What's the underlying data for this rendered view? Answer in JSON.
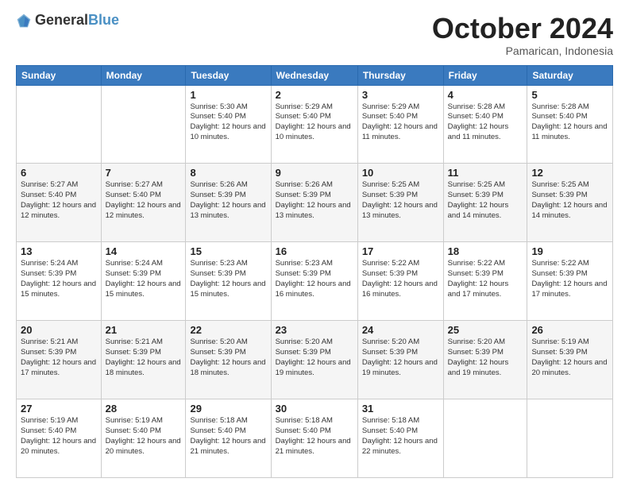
{
  "logo": {
    "text_general": "General",
    "text_blue": "Blue"
  },
  "header": {
    "month": "October 2024",
    "location": "Pamarican, Indonesia"
  },
  "days_of_week": [
    "Sunday",
    "Monday",
    "Tuesday",
    "Wednesday",
    "Thursday",
    "Friday",
    "Saturday"
  ],
  "weeks": [
    [
      null,
      null,
      {
        "day": 1,
        "sunrise": "5:30 AM",
        "sunset": "5:40 PM",
        "daylight": "12 hours and 10 minutes."
      },
      {
        "day": 2,
        "sunrise": "5:29 AM",
        "sunset": "5:40 PM",
        "daylight": "12 hours and 10 minutes."
      },
      {
        "day": 3,
        "sunrise": "5:29 AM",
        "sunset": "5:40 PM",
        "daylight": "12 hours and 11 minutes."
      },
      {
        "day": 4,
        "sunrise": "5:28 AM",
        "sunset": "5:40 PM",
        "daylight": "12 hours and 11 minutes."
      },
      {
        "day": 5,
        "sunrise": "5:28 AM",
        "sunset": "5:40 PM",
        "daylight": "12 hours and 11 minutes."
      }
    ],
    [
      {
        "day": 6,
        "sunrise": "5:27 AM",
        "sunset": "5:40 PM",
        "daylight": "12 hours and 12 minutes."
      },
      {
        "day": 7,
        "sunrise": "5:27 AM",
        "sunset": "5:40 PM",
        "daylight": "12 hours and 12 minutes."
      },
      {
        "day": 8,
        "sunrise": "5:26 AM",
        "sunset": "5:39 PM",
        "daylight": "12 hours and 13 minutes."
      },
      {
        "day": 9,
        "sunrise": "5:26 AM",
        "sunset": "5:39 PM",
        "daylight": "12 hours and 13 minutes."
      },
      {
        "day": 10,
        "sunrise": "5:25 AM",
        "sunset": "5:39 PM",
        "daylight": "12 hours and 13 minutes."
      },
      {
        "day": 11,
        "sunrise": "5:25 AM",
        "sunset": "5:39 PM",
        "daylight": "12 hours and 14 minutes."
      },
      {
        "day": 12,
        "sunrise": "5:25 AM",
        "sunset": "5:39 PM",
        "daylight": "12 hours and 14 minutes."
      }
    ],
    [
      {
        "day": 13,
        "sunrise": "5:24 AM",
        "sunset": "5:39 PM",
        "daylight": "12 hours and 15 minutes."
      },
      {
        "day": 14,
        "sunrise": "5:24 AM",
        "sunset": "5:39 PM",
        "daylight": "12 hours and 15 minutes."
      },
      {
        "day": 15,
        "sunrise": "5:23 AM",
        "sunset": "5:39 PM",
        "daylight": "12 hours and 15 minutes."
      },
      {
        "day": 16,
        "sunrise": "5:23 AM",
        "sunset": "5:39 PM",
        "daylight": "12 hours and 16 minutes."
      },
      {
        "day": 17,
        "sunrise": "5:22 AM",
        "sunset": "5:39 PM",
        "daylight": "12 hours and 16 minutes."
      },
      {
        "day": 18,
        "sunrise": "5:22 AM",
        "sunset": "5:39 PM",
        "daylight": "12 hours and 17 minutes."
      },
      {
        "day": 19,
        "sunrise": "5:22 AM",
        "sunset": "5:39 PM",
        "daylight": "12 hours and 17 minutes."
      }
    ],
    [
      {
        "day": 20,
        "sunrise": "5:21 AM",
        "sunset": "5:39 PM",
        "daylight": "12 hours and 17 minutes."
      },
      {
        "day": 21,
        "sunrise": "5:21 AM",
        "sunset": "5:39 PM",
        "daylight": "12 hours and 18 minutes."
      },
      {
        "day": 22,
        "sunrise": "5:20 AM",
        "sunset": "5:39 PM",
        "daylight": "12 hours and 18 minutes."
      },
      {
        "day": 23,
        "sunrise": "5:20 AM",
        "sunset": "5:39 PM",
        "daylight": "12 hours and 19 minutes."
      },
      {
        "day": 24,
        "sunrise": "5:20 AM",
        "sunset": "5:39 PM",
        "daylight": "12 hours and 19 minutes."
      },
      {
        "day": 25,
        "sunrise": "5:20 AM",
        "sunset": "5:39 PM",
        "daylight": "12 hours and 19 minutes."
      },
      {
        "day": 26,
        "sunrise": "5:19 AM",
        "sunset": "5:39 PM",
        "daylight": "12 hours and 20 minutes."
      }
    ],
    [
      {
        "day": 27,
        "sunrise": "5:19 AM",
        "sunset": "5:40 PM",
        "daylight": "12 hours and 20 minutes."
      },
      {
        "day": 28,
        "sunrise": "5:19 AM",
        "sunset": "5:40 PM",
        "daylight": "12 hours and 20 minutes."
      },
      {
        "day": 29,
        "sunrise": "5:18 AM",
        "sunset": "5:40 PM",
        "daylight": "12 hours and 21 minutes."
      },
      {
        "day": 30,
        "sunrise": "5:18 AM",
        "sunset": "5:40 PM",
        "daylight": "12 hours and 21 minutes."
      },
      {
        "day": 31,
        "sunrise": "5:18 AM",
        "sunset": "5:40 PM",
        "daylight": "12 hours and 22 minutes."
      },
      null,
      null
    ]
  ]
}
